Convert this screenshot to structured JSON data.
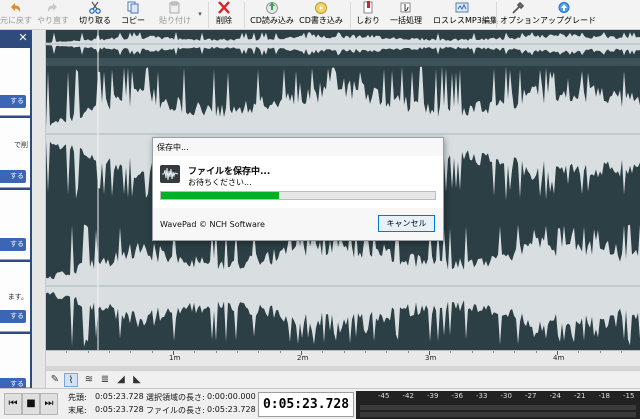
{
  "toolbar": {
    "undo": "元に戻す",
    "redo": "やり直す",
    "cut": "切り取る",
    "copy": "コピー",
    "paste": "貼り付け",
    "delete": "削除",
    "cd_read": "CD読み込み",
    "cd_write": "CD書き込み",
    "bookmark": "しおり",
    "batch": "一括処理",
    "lossless_mp3": "ロスレスMP3編集",
    "options": "オプション",
    "upgrade": "アップグレード"
  },
  "left_panel": {
    "card1_button": "する",
    "card2_text": "で削",
    "card2_button": "する",
    "card3_button": "する",
    "card4_text": "ます。",
    "card4_button": "する",
    "card5_button": "する"
  },
  "timeline": {
    "labels": [
      "1m",
      "2m",
      "3m",
      "4m"
    ]
  },
  "dialog": {
    "title": "保存中...",
    "heading": "ファイルを保存中...",
    "subtext": "お待ちください...",
    "progress": 0.43,
    "footer": "WavePad © NCH Software",
    "cancel": "キャンセル"
  },
  "transport": {
    "start_label": "先頭:",
    "start_value": "0:05:23.728",
    "end_label": "末尾:",
    "end_value": "0:05:23.728",
    "sel_length_label": "選択領域の長さ:",
    "sel_length_value": "0:00:00.000",
    "file_length_label": "ファイルの長さ:",
    "file_length_value": "0:05:23.728",
    "current_time": "0:05:23.728"
  },
  "meter": {
    "labels": [
      "-45",
      "-42",
      "-39",
      "-36",
      "-33",
      "-30",
      "-27",
      "-24",
      "-21",
      "-18",
      "-15"
    ]
  },
  "colors": {
    "waveform": "#d9dfe1",
    "waveform_bg": "#2c3f45",
    "progress": "#06b025",
    "panel": "#2f4a7c",
    "panel_button": "#3a66b5"
  },
  "icons": {
    "undo": "undo-arrow-icon",
    "redo": "redo-arrow-icon",
    "cut": "scissors-icon",
    "copy": "copy-icon",
    "paste": "paste-icon",
    "delete": "red-x-icon",
    "cd_read": "cd-read-icon",
    "cd_write": "cd-write-icon",
    "bookmark": "bookmark-icon",
    "batch": "batch-icon",
    "lossless_mp3": "lossless-mp3-icon",
    "options": "wrench-icon",
    "upgrade": "upgrade-icon"
  }
}
